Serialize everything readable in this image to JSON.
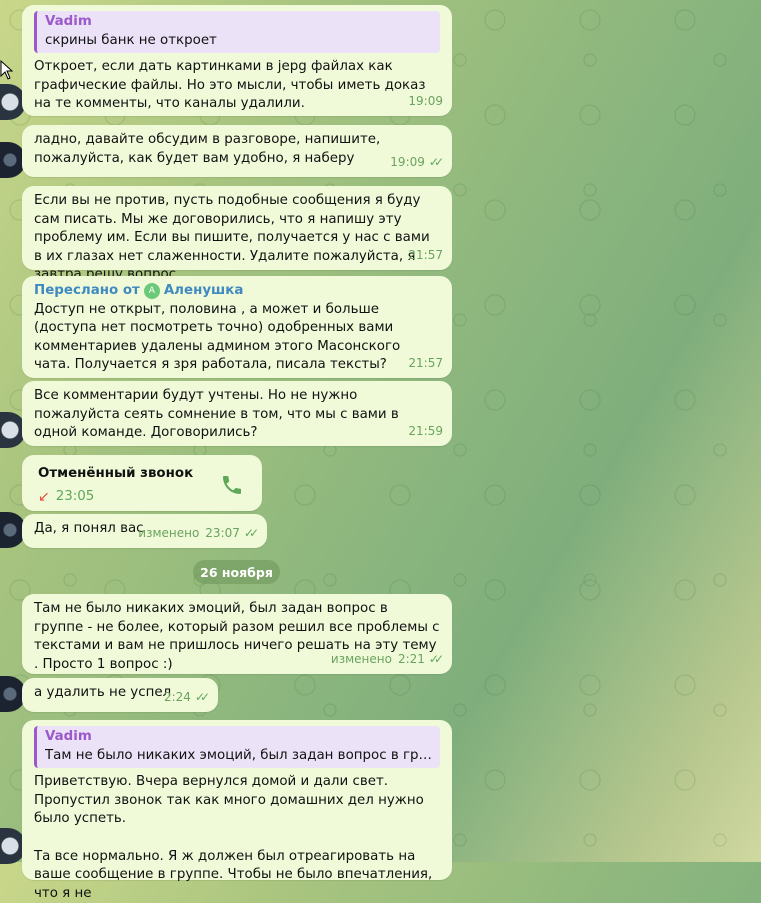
{
  "messages": {
    "m1": {
      "quote_name": "Vadim",
      "quote_text": "скрины банк не откроет",
      "text": "Откроет, если дать картинками в jepg файлах как графические файлы. Но это мысли, чтобы иметь доказ на те комменты, что каналы удалили.",
      "time": "19:09"
    },
    "m2": {
      "text": "ладно, давайте обсудим в разговоре,  напишите, пожалуйста, как будет вам удобно, я наберу",
      "time": "19:09"
    },
    "m3": {
      "text": "Если вы не против, пусть подобные сообщения я буду сам писать. Мы же договорились, что я напишу эту проблему им. Если вы пишите, получается у нас с вами в их глазах нет слаженности. Удалите пожалуйста, я завтра решу вопрос.",
      "time": "21:57"
    },
    "m4": {
      "forward_prefix": "Переслано от",
      "forward_avatar_letter": "A",
      "forward_name": "Аленушка",
      "text": "Доступ не открыт, половина ,  а может и больше (доступа нет посмотреть точно)   одобренных вами комментариев удалены админом этого Масонского чата. Получается я зря работала, писала тексты?",
      "time": "21:57"
    },
    "m5": {
      "text": "Все комментарии будут учтены. Но не нужно пожалуйста сеять сомнение в том, что мы с вами в одной команде. Договорились?",
      "time": "21:59"
    },
    "call": {
      "title": "Отменённый звонок",
      "time": "23:05"
    },
    "m6": {
      "text": "Да, я понял вас",
      "edited": "изменено",
      "time": "23:07"
    },
    "date_separator": "26 ноября",
    "m7": {
      "text": "Там не было никаких эмоций, был задан вопрос в группе - не более, который разом решил все проблемы с текстами и вам не пришлось ничего решать на эту тему . Просто 1 вопрос :)",
      "edited": "изменено",
      "time": "2:21"
    },
    "m8": {
      "text": "а удалить не успел",
      "time": "2:24"
    },
    "m9": {
      "quote_name": "Vadim",
      "quote_text": "Там не было никаких эмоций, был задан вопрос в группе - не более...",
      "text": "Приветствую. Вчера вернулся домой и дали свет. Пропустил звонок так как много домашних дел нужно было успеть.\n\nТа все нормально. Я ж должен был отреагировать на ваше сообщение в группе. Чтобы не было впечатления, что я не"
    }
  },
  "colors": {
    "bubble": "#f0fad9",
    "accent_green": "#5fa85a",
    "quote_purple": "#9b59c9",
    "forward_blue": "#3f8ac1"
  }
}
